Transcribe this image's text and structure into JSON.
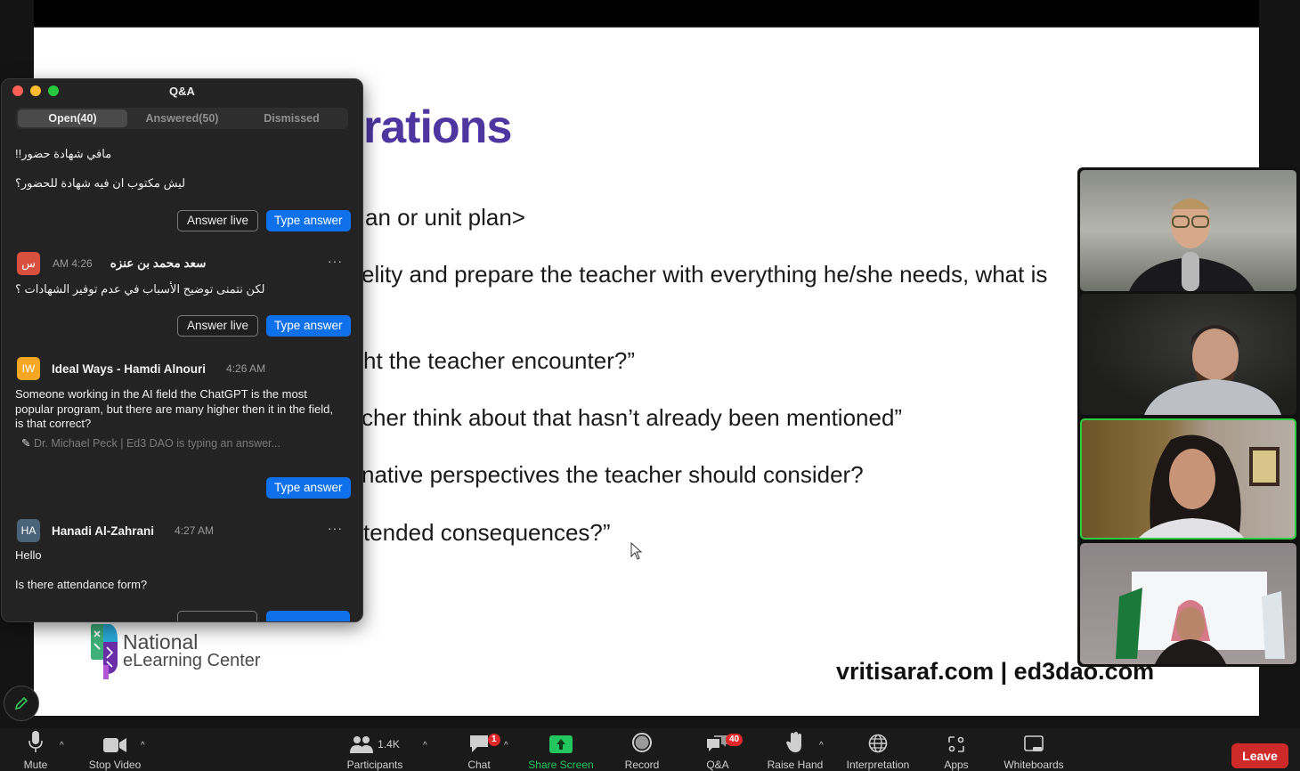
{
  "slide": {
    "title_fragment": "rations",
    "lines": [
      "an or unit plan>",
      "elity and prepare the teacher with everything he/she needs, what is",
      "ht the teacher encounter?”",
      "cher think about that hasn’t already been mentioned”",
      "native perspectives the teacher should consider?",
      "tended consequences?”"
    ],
    "footer_url": "vritisaraf.com | ed3dao.com",
    "logo": {
      "line1": "National",
      "line2": "eLearning Center"
    }
  },
  "qa": {
    "title": "Q&A",
    "tabs": [
      {
        "label": "Open(40)",
        "active": true
      },
      {
        "label": "Answered(50)",
        "active": false
      },
      {
        "label": "Dismissed",
        "active": false
      }
    ],
    "items": [
      {
        "lines": [
          "مافي شهادة حضور!!",
          "ليش مكتوب ان فيه شهادة للحضور؟"
        ],
        "answer_live": "Answer live",
        "type_answer": "Type answer"
      },
      {
        "avatar": "س",
        "avatar_color": "#d9503f",
        "name": "سعد محمد بن عنزه",
        "time": "AM 4:26",
        "more": "···",
        "text": "لكن نتمنى توضيح الأسباب في عدم توفير الشهادات ؟",
        "answer_live": "Answer live",
        "type_answer": "Type answer"
      },
      {
        "avatar": "IW",
        "avatar_color": "#f5a623",
        "name": "Ideal Ways - Hamdi Alnouri",
        "time": "4:26 AM",
        "text": "Someone working in the AI field the ChatGPT is the most popular program, but there are many higher then it in the field, is that correct?",
        "typing": "Dr. Michael Peck | Ed3 DAO is typing an answer...",
        "type_answer": "Type answer"
      },
      {
        "avatar": "HA",
        "avatar_color": "#4a6378",
        "name": "Hanadi Al-Zahrani",
        "time": "4:27 AM",
        "more": "···",
        "lines": [
          "Hello",
          "Is there attendance form?"
        ]
      }
    ]
  },
  "gallery": {
    "tiles": [
      {
        "name": "participant-1",
        "active": false
      },
      {
        "name": "participant-2",
        "active": false
      },
      {
        "name": "participant-3",
        "active": true
      },
      {
        "name": "participant-4",
        "active": false
      }
    ]
  },
  "toolbar": {
    "mute": "Mute",
    "stop_video": "Stop Video",
    "participants": "Participants",
    "participants_count": "1.4K",
    "chat": "Chat",
    "chat_badge": "1",
    "share_screen": "Share Screen",
    "record": "Record",
    "qa": "Q&A",
    "qa_badge": "40",
    "raise_hand": "Raise Hand",
    "interpretation": "Interpretation",
    "apps": "Apps",
    "whiteboards": "Whiteboards",
    "leave": "Leave",
    "caret": "^"
  },
  "colors": {
    "accent_blue": "#0e71eb",
    "share_green": "#22c55e",
    "leave_red": "#cf2a2a",
    "slide_title_purple": "#4e35a0",
    "active_speaker_green": "#2ecc40"
  }
}
